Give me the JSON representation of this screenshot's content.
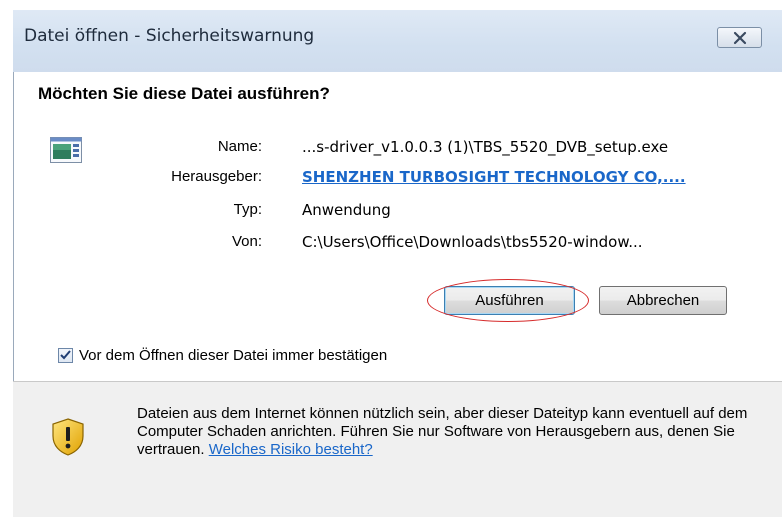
{
  "window": {
    "title": "Datei öffnen - Sicherheitswarnung",
    "close_icon": "close-icon"
  },
  "question": "Möchten Sie diese Datei ausführen?",
  "file_icon": "application-file-icon",
  "details": {
    "name_label": "Name:",
    "name_value": "...s-driver_v1.0.0.3 (1)\\TBS_5520_DVB_setup.exe",
    "publisher_label": "Herausgeber:",
    "publisher_value": "SHENZHEN TURBOSIGHT TECHNOLOGY CO,....",
    "type_label": "Typ:",
    "type_value": "Anwendung",
    "from_label": "Von:",
    "from_value": "C:\\Users\\Office\\Downloads\\tbs5520-window..."
  },
  "buttons": {
    "run": "Ausführen",
    "cancel": "Abbrechen"
  },
  "checkbox": {
    "label": "Vor dem Öffnen dieser Datei immer bestätigen",
    "checked": true
  },
  "warning": {
    "text": "Dateien aus dem Internet können nützlich sein, aber dieser Dateityp kann eventuell auf dem Computer Schaden anrichten. Führen Sie nur Software von Herausgebern aus, denen Sie vertrauen. ",
    "link": "Welches Risiko besteht?",
    "icon": "security-shield-icon"
  },
  "colors": {
    "link": "#1a67c9",
    "annotation": "#d62b2b",
    "titlebar": "#d2e0f0"
  }
}
